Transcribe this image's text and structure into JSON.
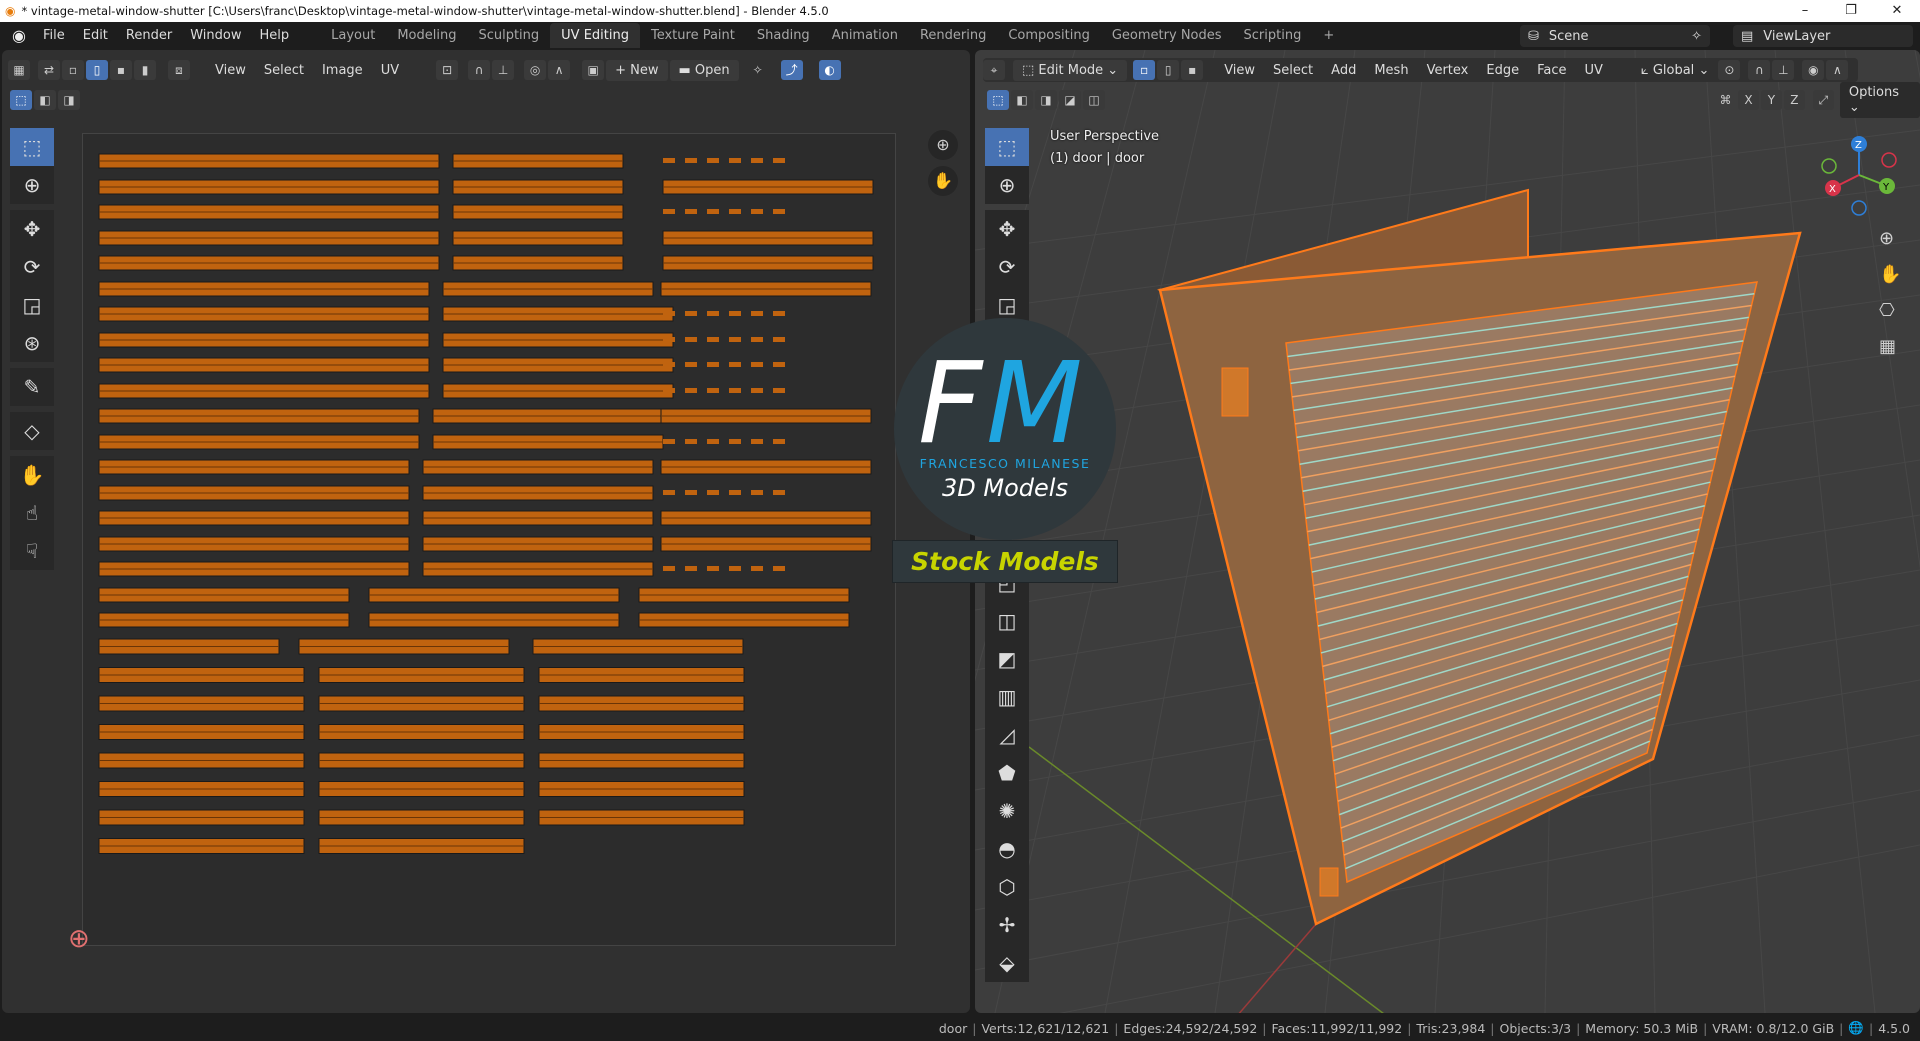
{
  "window": {
    "title": "* vintage-metal-window-shutter [C:\\Users\\franc\\Desktop\\vintage-metal-window-shutter\\vintage-metal-window-shutter.blend] - Blender 4.5.0",
    "minimize": "–",
    "maximize": "❐",
    "close": "✕"
  },
  "menu": [
    "File",
    "Edit",
    "Render",
    "Window",
    "Help"
  ],
  "workspaces": [
    {
      "label": "Layout"
    },
    {
      "label": "Modeling"
    },
    {
      "label": "Sculpting"
    },
    {
      "label": "UV Editing",
      "active": true
    },
    {
      "label": "Texture Paint"
    },
    {
      "label": "Shading"
    },
    {
      "label": "Animation"
    },
    {
      "label": "Rendering"
    },
    {
      "label": "Compositing"
    },
    {
      "label": "Geometry Nodes"
    },
    {
      "label": "Scripting"
    }
  ],
  "add_workspace": "+",
  "scene": {
    "label": "Scene",
    "viewlayer": "ViewLayer"
  },
  "uv_editor": {
    "menus": [
      "View",
      "Select",
      "Image",
      "UV"
    ],
    "new_label": "New",
    "open_label": "Open"
  },
  "viewport": {
    "mode": "Edit Mode",
    "menus": [
      "View",
      "Select",
      "Add",
      "Mesh",
      "Vertex",
      "Edge",
      "Face",
      "UV"
    ],
    "orientation": "Global",
    "axes": [
      "X",
      "Y",
      "Z"
    ],
    "options": "Options",
    "view_name": "User Perspective",
    "object_info": "(1) door | door"
  },
  "watermark": {
    "initials_f": "F",
    "initials_m": "M",
    "name": "FRANCESCO MILANESE",
    "tagline": "3D Models",
    "banner": "Stock Models"
  },
  "gizmo": {
    "x": "X",
    "y": "Y",
    "z": "Z"
  },
  "status": {
    "items": [
      "door",
      "Verts:12,621/12,621",
      "Edges:24,592/24,592",
      "Faces:11,992/11,992",
      "Tris:23,984",
      "Objects:3/3",
      "Memory: 50.3 MiB",
      "VRAM: 0.8/12.0 GiB"
    ],
    "version": "4.5.0"
  },
  "colors": {
    "accent": "#4772b3",
    "selection": "#ff7a1a",
    "uv_island": "#c0630f",
    "logo_blue": "#1fa5e0",
    "banner_text": "#c8d400"
  }
}
